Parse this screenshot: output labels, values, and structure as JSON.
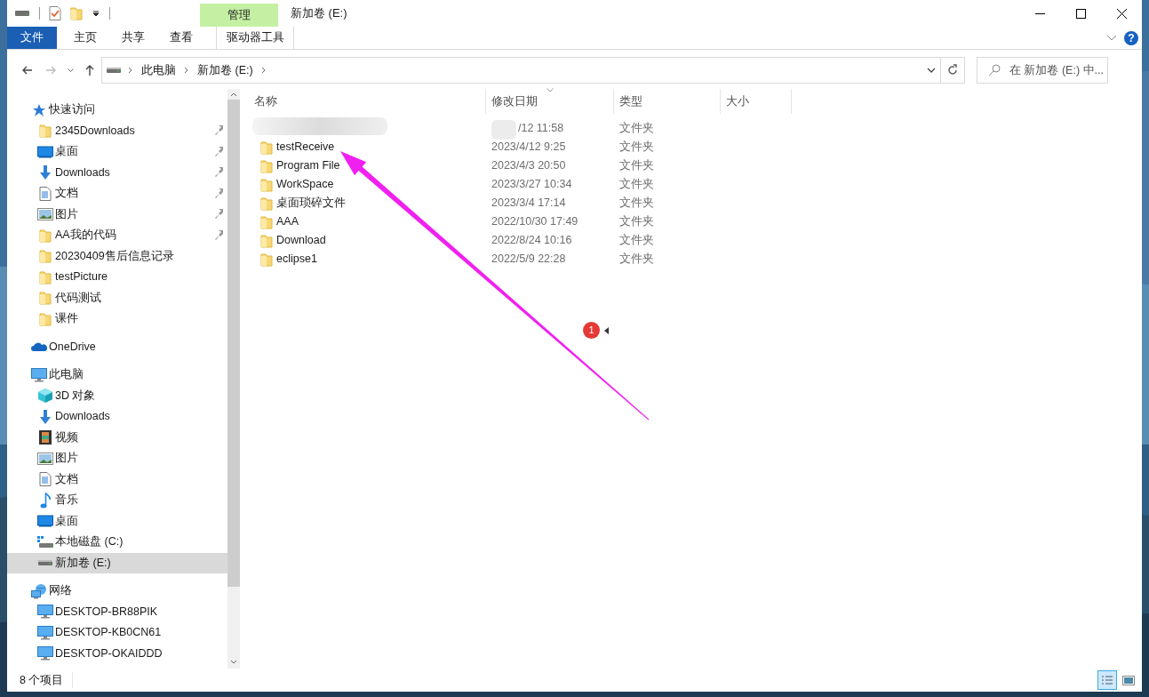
{
  "window": {
    "title": "新加卷 (E:)",
    "context_group": "管理"
  },
  "ribbon_tabs": [
    {
      "label": "文件",
      "kind": "file"
    },
    {
      "label": "主页",
      "kind": "normal"
    },
    {
      "label": "共享",
      "kind": "normal"
    },
    {
      "label": "查看",
      "kind": "normal"
    },
    {
      "label": "驱动器工具",
      "kind": "contextual"
    }
  ],
  "address_bar": {
    "path": [
      "此电脑",
      "新加卷 (E:)"
    ]
  },
  "search": {
    "placeholder": "在 新加卷 (E:) 中..."
  },
  "sidebar": {
    "items": [
      {
        "label": "快速访问",
        "kind": "star",
        "selected": false,
        "children": [
          {
            "label": "2345Downloads",
            "kind": "folder",
            "selected": false,
            "pinned": true
          },
          {
            "label": "桌面",
            "kind": "desktop",
            "selected": false,
            "pinned": true
          },
          {
            "label": "Downloads",
            "kind": "download",
            "selected": false,
            "pinned": true
          },
          {
            "label": "文档",
            "kind": "document",
            "selected": false,
            "pinned": true
          },
          {
            "label": "图片",
            "kind": "pictures",
            "selected": false,
            "pinned": true
          },
          {
            "label": "AA我的代码",
            "kind": "folder",
            "selected": false,
            "pinned": true
          },
          {
            "label": "20230409售后信息记录",
            "kind": "folder",
            "selected": false,
            "pinned": false
          },
          {
            "label": "testPicture",
            "kind": "folder",
            "selected": false,
            "pinned": false
          },
          {
            "label": "代码测试",
            "kind": "folder",
            "selected": false,
            "pinned": false
          },
          {
            "label": "课件",
            "kind": "folder",
            "selected": false,
            "pinned": false
          }
        ]
      },
      {
        "label": "OneDrive",
        "kind": "cloud",
        "selected": false
      },
      {
        "label": "此电脑",
        "kind": "pc",
        "selected": false,
        "children": [
          {
            "label": "3D 对象",
            "kind": "cube",
            "selected": false
          },
          {
            "label": "Downloads",
            "kind": "download",
            "selected": false
          },
          {
            "label": "视频",
            "kind": "video",
            "selected": false
          },
          {
            "label": "图片",
            "kind": "pictures",
            "selected": false
          },
          {
            "label": "文档",
            "kind": "document",
            "selected": false
          },
          {
            "label": "音乐",
            "kind": "music",
            "selected": false
          },
          {
            "label": "桌面",
            "kind": "desktop",
            "selected": false
          },
          {
            "label": "本地磁盘 (C:)",
            "kind": "system-drive",
            "selected": false
          },
          {
            "label": "新加卷 (E:)",
            "kind": "drive",
            "selected": true
          }
        ]
      },
      {
        "label": "网络",
        "kind": "network",
        "selected": false,
        "children": [
          {
            "label": "DESKTOP-BR88PIK",
            "kind": "pc",
            "selected": false
          },
          {
            "label": "DESKTOP-KB0CN61",
            "kind": "pc",
            "selected": false
          },
          {
            "label": "DESKTOP-OKAIDDD",
            "kind": "pc",
            "selected": false
          }
        ]
      }
    ]
  },
  "columns": [
    {
      "label": "名称",
      "sorted": false
    },
    {
      "label": "修改日期",
      "sorted": true
    },
    {
      "label": "类型",
      "sorted": false
    },
    {
      "label": "大小",
      "sorted": false
    }
  ],
  "files": [
    {
      "date": "/12 11:58",
      "type": "文件夹",
      "obscured": true
    },
    {
      "name": "testReceive",
      "date": "2023/4/12 9:25",
      "type": "文件夹",
      "obscured": false
    },
    {
      "name": "Program File",
      "date": "2023/4/3 20:50",
      "type": "文件夹",
      "obscured": false
    },
    {
      "name": "WorkSpace",
      "date": "2023/3/27 10:34",
      "type": "文件夹",
      "obscured": false
    },
    {
      "name": "桌面琐碎文件",
      "date": "2023/3/4 17:14",
      "type": "文件夹",
      "obscured": false
    },
    {
      "name": "AAA",
      "date": "2022/10/30 17:49",
      "type": "文件夹",
      "obscured": false
    },
    {
      "name": "Download",
      "date": "2022/8/24 10:16",
      "type": "文件夹",
      "obscured": false
    },
    {
      "name": "eclipse1",
      "date": "2022/5/9 22:28",
      "type": "文件夹",
      "obscured": false
    }
  ],
  "notification_badge": "1",
  "help_button": "?",
  "status_bar": {
    "item_count": "8 个项目",
    "views": [
      {
        "kind": "details",
        "selected": true
      },
      {
        "kind": "large-icons",
        "selected": false
      }
    ]
  }
}
